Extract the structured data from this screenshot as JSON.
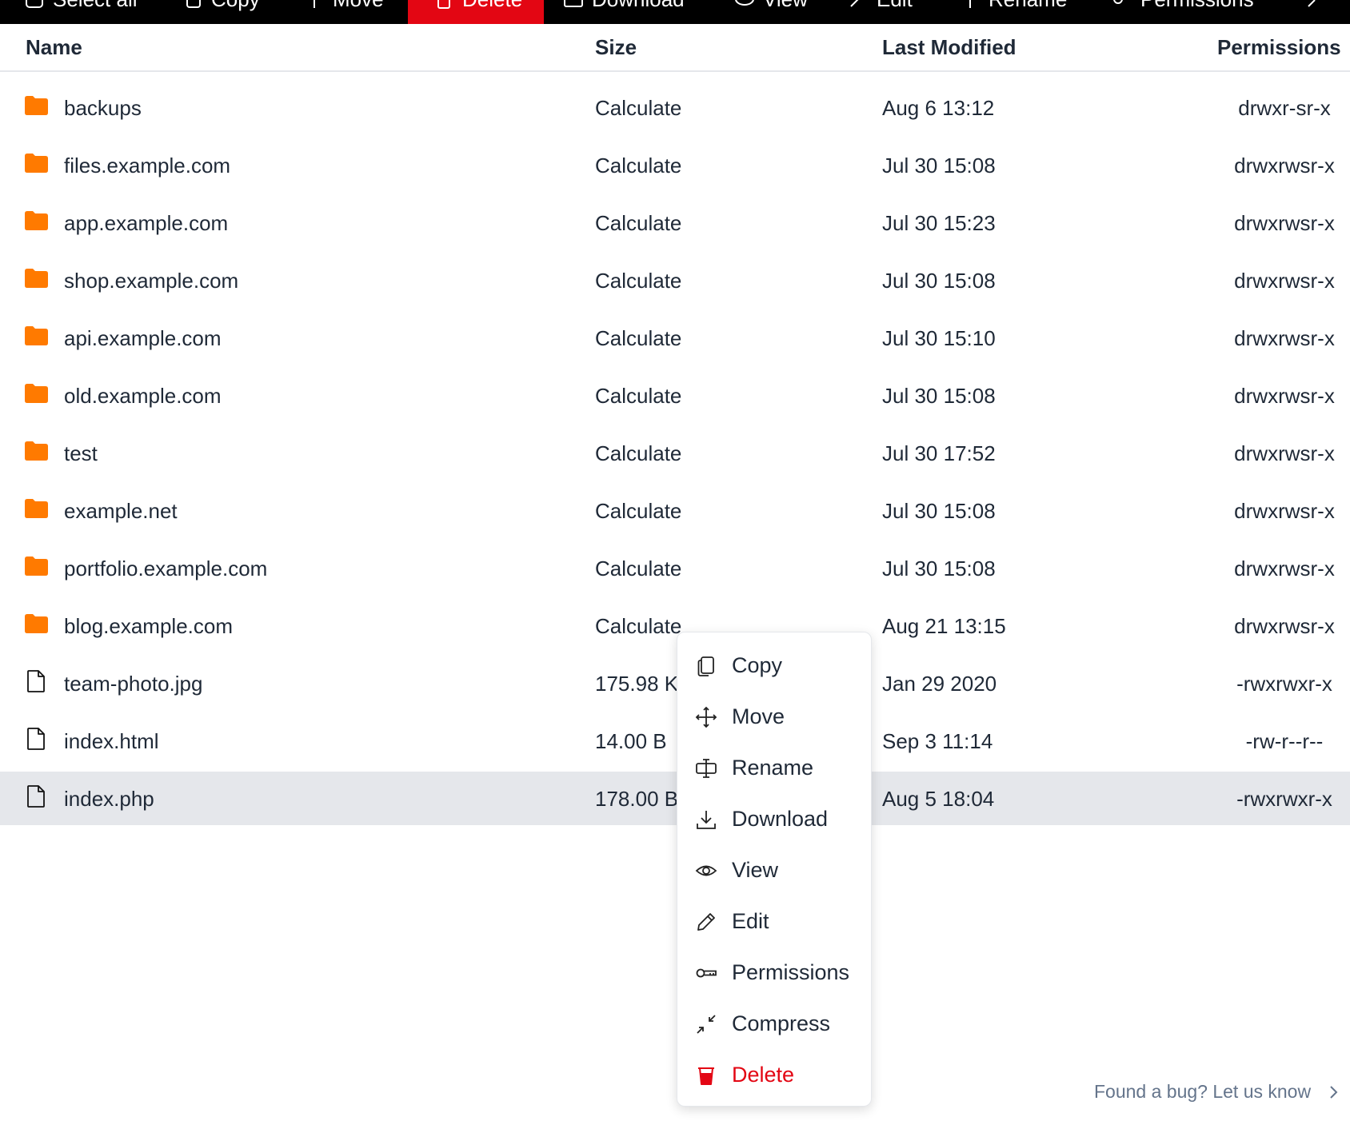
{
  "toolbar": {
    "buttons": [
      {
        "label": "Select all",
        "icon": "select-all-icon"
      },
      {
        "label": "Copy",
        "icon": "copy-icon"
      },
      {
        "label": "Move",
        "icon": "move-icon"
      },
      {
        "label": "Delete",
        "icon": "trash-icon",
        "active": true
      },
      {
        "label": "Download",
        "icon": "download-icon"
      },
      {
        "label": "View",
        "icon": "eye-icon"
      },
      {
        "label": "Edit",
        "icon": "pencil-icon"
      },
      {
        "label": "Rename",
        "icon": "rename-icon"
      },
      {
        "label": "Permissions",
        "icon": "key-icon"
      }
    ]
  },
  "table": {
    "headers": {
      "name": "Name",
      "size": "Size",
      "modified": "Last Modified",
      "permissions": "Permissions"
    },
    "rows": [
      {
        "type": "folder",
        "name": "backups",
        "size": "Calculate",
        "modified": "Aug 6 13:12",
        "permissions": "drwxr-sr-x"
      },
      {
        "type": "folder",
        "name": "files.example.com",
        "size": "Calculate",
        "modified": "Jul 30 15:08",
        "permissions": "drwxrwsr-x"
      },
      {
        "type": "folder",
        "name": "app.example.com",
        "size": "Calculate",
        "modified": "Jul 30 15:23",
        "permissions": "drwxrwsr-x"
      },
      {
        "type": "folder",
        "name": "shop.example.com",
        "size": "Calculate",
        "modified": "Jul 30 15:08",
        "permissions": "drwxrwsr-x"
      },
      {
        "type": "folder",
        "name": "api.example.com",
        "size": "Calculate",
        "modified": "Jul 30 15:10",
        "permissions": "drwxrwsr-x"
      },
      {
        "type": "folder",
        "name": "old.example.com",
        "size": "Calculate",
        "modified": "Jul 30 15:08",
        "permissions": "drwxrwsr-x"
      },
      {
        "type": "folder",
        "name": "test",
        "size": "Calculate",
        "modified": "Jul 30 17:52",
        "permissions": "drwxrwsr-x"
      },
      {
        "type": "folder",
        "name": "example.net",
        "size": "Calculate",
        "modified": "Jul 30 15:08",
        "permissions": "drwxrwsr-x"
      },
      {
        "type": "folder",
        "name": "portfolio.example.com",
        "size": "Calculate",
        "modified": "Jul 30 15:08",
        "permissions": "drwxrwsr-x"
      },
      {
        "type": "folder",
        "name": "blog.example.com",
        "size": "Calculate",
        "modified": "Aug 21 13:15",
        "permissions": "drwxrwsr-x"
      },
      {
        "type": "file",
        "name": "team-photo.jpg",
        "size": "175.98 K",
        "modified": "Jan 29 2020",
        "permissions": "-rwxrwxr-x"
      },
      {
        "type": "file",
        "name": "index.html",
        "size": "14.00 B",
        "modified": "Sep 3 11:14",
        "permissions": "-rw-r--r--"
      },
      {
        "type": "file",
        "name": "index.php",
        "size": "178.00 B",
        "modified": "Aug 5 18:04",
        "permissions": "-rwxrwxr-x",
        "selected": true
      }
    ]
  },
  "context_menu": {
    "items": [
      {
        "label": "Copy",
        "icon": "copy-icon"
      },
      {
        "label": "Move",
        "icon": "move-icon"
      },
      {
        "label": "Rename",
        "icon": "rename-icon"
      },
      {
        "label": "Download",
        "icon": "download-icon"
      },
      {
        "label": "View",
        "icon": "eye-icon"
      },
      {
        "label": "Edit",
        "icon": "pencil-icon"
      },
      {
        "label": "Permissions",
        "icon": "key-icon"
      },
      {
        "label": "Compress",
        "icon": "compress-icon"
      },
      {
        "label": "Delete",
        "icon": "trash-icon",
        "danger": true
      }
    ]
  },
  "footer": {
    "bug_link": "Found a bug? Let us know"
  },
  "colors": {
    "folder": "#ff7a00",
    "danger": "#e30613",
    "selected_row": "#e5e7eb",
    "toolbar_bg": "#000000"
  }
}
